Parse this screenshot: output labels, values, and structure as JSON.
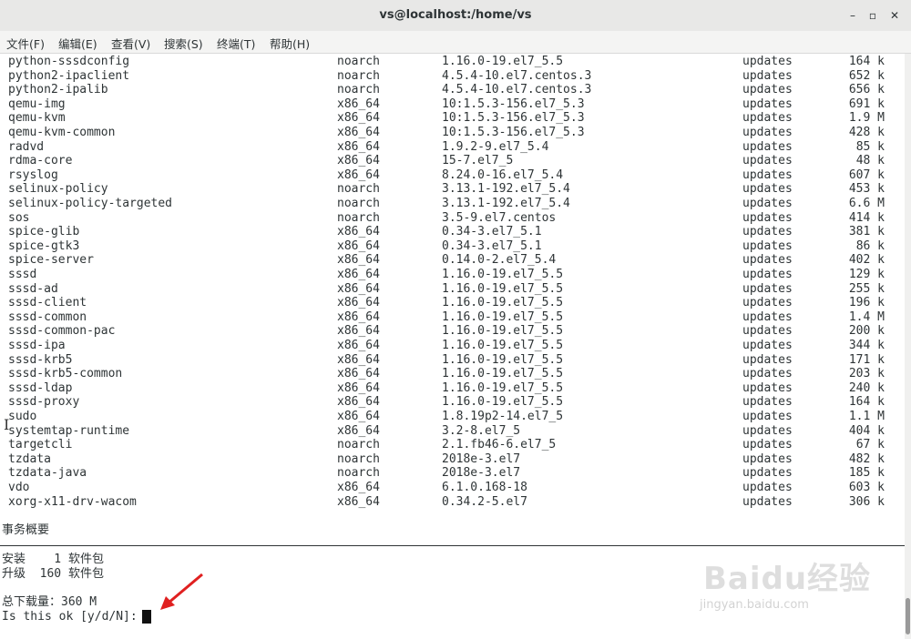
{
  "window": {
    "title": "vs@localhost:/home/vs",
    "minimize": "–",
    "maximize": "▫",
    "close": "✕"
  },
  "menu": [
    "文件(F)",
    "编辑(E)",
    "查看(V)",
    "搜索(S)",
    "终端(T)",
    "帮助(H)"
  ],
  "packages": [
    {
      "name": "python-sssdconfig",
      "arch": "noarch",
      "version": "1.16.0-19.el7_5.5",
      "repo": "updates",
      "size": "164 k"
    },
    {
      "name": "python2-ipaclient",
      "arch": "noarch",
      "version": "4.5.4-10.el7.centos.3",
      "repo": "updates",
      "size": "652 k"
    },
    {
      "name": "python2-ipalib",
      "arch": "noarch",
      "version": "4.5.4-10.el7.centos.3",
      "repo": "updates",
      "size": "656 k"
    },
    {
      "name": "qemu-img",
      "arch": "x86_64",
      "version": "10:1.5.3-156.el7_5.3",
      "repo": "updates",
      "size": "691 k"
    },
    {
      "name": "qemu-kvm",
      "arch": "x86_64",
      "version": "10:1.5.3-156.el7_5.3",
      "repo": "updates",
      "size": "1.9 M"
    },
    {
      "name": "qemu-kvm-common",
      "arch": "x86_64",
      "version": "10:1.5.3-156.el7_5.3",
      "repo": "updates",
      "size": "428 k"
    },
    {
      "name": "radvd",
      "arch": "x86_64",
      "version": "1.9.2-9.el7_5.4",
      "repo": "updates",
      "size": "85 k"
    },
    {
      "name": "rdma-core",
      "arch": "x86_64",
      "version": "15-7.el7_5",
      "repo": "updates",
      "size": "48 k"
    },
    {
      "name": "rsyslog",
      "arch": "x86_64",
      "version": "8.24.0-16.el7_5.4",
      "repo": "updates",
      "size": "607 k"
    },
    {
      "name": "selinux-policy",
      "arch": "noarch",
      "version": "3.13.1-192.el7_5.4",
      "repo": "updates",
      "size": "453 k"
    },
    {
      "name": "selinux-policy-targeted",
      "arch": "noarch",
      "version": "3.13.1-192.el7_5.4",
      "repo": "updates",
      "size": "6.6 M"
    },
    {
      "name": "sos",
      "arch": "noarch",
      "version": "3.5-9.el7.centos",
      "repo": "updates",
      "size": "414 k"
    },
    {
      "name": "spice-glib",
      "arch": "x86_64",
      "version": "0.34-3.el7_5.1",
      "repo": "updates",
      "size": "381 k"
    },
    {
      "name": "spice-gtk3",
      "arch": "x86_64",
      "version": "0.34-3.el7_5.1",
      "repo": "updates",
      "size": "86 k"
    },
    {
      "name": "spice-server",
      "arch": "x86_64",
      "version": "0.14.0-2.el7_5.4",
      "repo": "updates",
      "size": "402 k"
    },
    {
      "name": "sssd",
      "arch": "x86_64",
      "version": "1.16.0-19.el7_5.5",
      "repo": "updates",
      "size": "129 k"
    },
    {
      "name": "sssd-ad",
      "arch": "x86_64",
      "version": "1.16.0-19.el7_5.5",
      "repo": "updates",
      "size": "255 k"
    },
    {
      "name": "sssd-client",
      "arch": "x86_64",
      "version": "1.16.0-19.el7_5.5",
      "repo": "updates",
      "size": "196 k"
    },
    {
      "name": "sssd-common",
      "arch": "x86_64",
      "version": "1.16.0-19.el7_5.5",
      "repo": "updates",
      "size": "1.4 M"
    },
    {
      "name": "sssd-common-pac",
      "arch": "x86_64",
      "version": "1.16.0-19.el7_5.5",
      "repo": "updates",
      "size": "200 k"
    },
    {
      "name": "sssd-ipa",
      "arch": "x86_64",
      "version": "1.16.0-19.el7_5.5",
      "repo": "updates",
      "size": "344 k"
    },
    {
      "name": "sssd-krb5",
      "arch": "x86_64",
      "version": "1.16.0-19.el7_5.5",
      "repo": "updates",
      "size": "171 k"
    },
    {
      "name": "sssd-krb5-common",
      "arch": "x86_64",
      "version": "1.16.0-19.el7_5.5",
      "repo": "updates",
      "size": "203 k"
    },
    {
      "name": "sssd-ldap",
      "arch": "x86_64",
      "version": "1.16.0-19.el7_5.5",
      "repo": "updates",
      "size": "240 k"
    },
    {
      "name": "sssd-proxy",
      "arch": "x86_64",
      "version": "1.16.0-19.el7_5.5",
      "repo": "updates",
      "size": "164 k"
    },
    {
      "name": "sudo",
      "arch": "x86_64",
      "version": "1.8.19p2-14.el7_5",
      "repo": "updates",
      "size": "1.1 M"
    },
    {
      "name": "systemtap-runtime",
      "arch": "x86_64",
      "version": "3.2-8.el7_5",
      "repo": "updates",
      "size": "404 k"
    },
    {
      "name": "targetcli",
      "arch": "noarch",
      "version": "2.1.fb46-6.el7_5",
      "repo": "updates",
      "size": "67 k"
    },
    {
      "name": "tzdata",
      "arch": "noarch",
      "version": "2018e-3.el7",
      "repo": "updates",
      "size": "482 k"
    },
    {
      "name": "tzdata-java",
      "arch": "noarch",
      "version": "2018e-3.el7",
      "repo": "updates",
      "size": "185 k"
    },
    {
      "name": "vdo",
      "arch": "x86_64",
      "version": "6.1.0.168-18",
      "repo": "updates",
      "size": "603 k"
    },
    {
      "name": "xorg-x11-drv-wacom",
      "arch": "x86_64",
      "version": "0.34.2-5.el7",
      "repo": "updates",
      "size": "306 k"
    }
  ],
  "summary": {
    "heading": "事务概要",
    "install": "安装    1 软件包",
    "upgrade": "升级  160 软件包",
    "download": "总下载量：360 M",
    "prompt": "Is this ok [y/d/N]: "
  },
  "watermark": {
    "logo": "Baidu经验",
    "url": "jingyan.baidu.com"
  },
  "colors": {
    "annotation_arrow": "#e02020"
  }
}
